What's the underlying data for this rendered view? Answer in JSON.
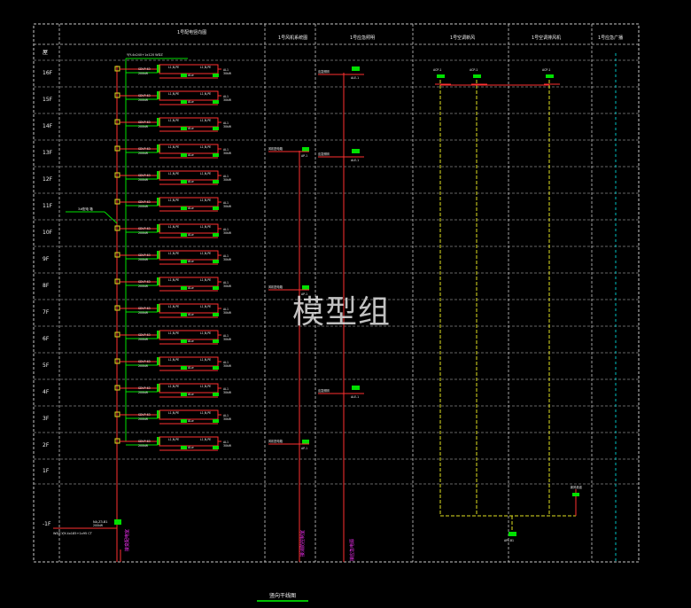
{
  "header": {
    "floor": "楼 层",
    "col1": "1号配电竖向图",
    "col2": "1号风机系统图",
    "col3": "1号应急照明",
    "col4": "1号空调新风",
    "col5": "1号空调排风机",
    "col6": "1号应急广播"
  },
  "floors": [
    "屋",
    "16F",
    "15F",
    "14F",
    "13F",
    "12F",
    "11F",
    "10F",
    "9F",
    "8F",
    "7F",
    "6F",
    "5F",
    "4F",
    "3F",
    "2F",
    "1F",
    "-1F"
  ],
  "texts": {
    "trunk_label": "YJY-4x240+1x120 WDZ",
    "tap_label": "3#配电 箱",
    "breaker_left": "SDVP-63",
    "breaker_right": "AL1",
    "box_label": "L1,N,PE",
    "right_label": "ALw",
    "fan_label": "风机配电箱",
    "fan_sub": "AP-1",
    "light_label": "应急照明",
    "light_sub": "ALE-1",
    "top_label": "ACP-1",
    "basement_label": "NA,Z3-B1",
    "basement_sub": "WDZ-YJY-4x185+1x95 CT",
    "basement_small": "200kW",
    "vert_main": "接变配电室",
    "vert_fan": "接消防控制室",
    "vert_light": "接应急电源",
    "bottom_box": "APL-B1",
    "bottom_right": "新风机组",
    "bottom_title": "竖向干线图"
  },
  "colors": {
    "grid": "#c8c8c8",
    "trunk": "#ff3030",
    "green": "#00e000",
    "yellow": "#e0e020",
    "cyan": "#00c0c0",
    "magenta": "#ff30ff",
    "text": "#f0f0f0"
  },
  "watermark": "模型组"
}
